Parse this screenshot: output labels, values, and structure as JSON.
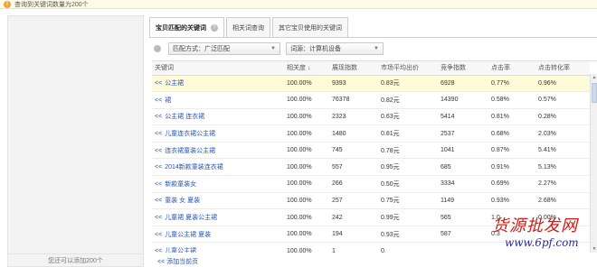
{
  "notice": {
    "text": "查询到关键词数量为200个"
  },
  "left_panel": {
    "footer": "您还可以添加200个"
  },
  "tabs": [
    {
      "label": "宝贝匹配的关键词",
      "active": true
    },
    {
      "label": "相关词查询",
      "active": false
    },
    {
      "label": "其它宝贝使用的关键词",
      "active": false
    }
  ],
  "filters": {
    "match_label": "匹配方式：广泛匹配",
    "source_label": "词源：计算机设备"
  },
  "table": {
    "columns": [
      "关键词",
      "相关度",
      "展现指数",
      "市场平均出价",
      "竞争指数",
      "点击率",
      "点击转化率"
    ],
    "sort_icon": "↓",
    "add_prefix": "<<",
    "rows": [
      {
        "keyword": "公主裙",
        "relevance": "100.00%",
        "impressions": "9393",
        "avg_bid": "0.83元",
        "competition": "6928",
        "ctr": "0.77%",
        "cvr": "0.96%"
      },
      {
        "keyword": "裙",
        "relevance": "100.00%",
        "impressions": "76378",
        "avg_bid": "0.82元",
        "competition": "14390",
        "ctr": "0.58%",
        "cvr": "0.57%"
      },
      {
        "keyword": "公主裙 连衣裙",
        "relevance": "100.00%",
        "impressions": "2323",
        "avg_bid": "0.63元",
        "competition": "5414",
        "ctr": "0.81%",
        "cvr": "0.28%"
      },
      {
        "keyword": "儿童连衣裙公主裙",
        "relevance": "100.00%",
        "impressions": "1480",
        "avg_bid": "0.81元",
        "competition": "2537",
        "ctr": "0.68%",
        "cvr": "2.03%"
      },
      {
        "keyword": "连衣裙童装公主裙",
        "relevance": "100.00%",
        "impressions": "745",
        "avg_bid": "0.78元",
        "competition": "1041",
        "ctr": "0.87%",
        "cvr": "5.41%"
      },
      {
        "keyword": "2014新款童装连衣裙",
        "relevance": "100.00%",
        "impressions": "557",
        "avg_bid": "0.95元",
        "competition": "685",
        "ctr": "0.91%",
        "cvr": "5.13%"
      },
      {
        "keyword": "新款童装女",
        "relevance": "100.00%",
        "impressions": "266",
        "avg_bid": "0.50元",
        "competition": "3334",
        "ctr": "0.69%",
        "cvr": "2.27%"
      },
      {
        "keyword": "童装 女 夏装",
        "relevance": "100.00%",
        "impressions": "257",
        "avg_bid": "0.75元",
        "competition": "1149",
        "ctr": "0.93%",
        "cvr": "2.68%"
      },
      {
        "keyword": "儿童裙 夏装公主裙",
        "relevance": "100.00%",
        "impressions": "242",
        "avg_bid": "0.99元",
        "competition": "565",
        "ctr": "1.0",
        "cvr": "0.00%"
      },
      {
        "keyword": "儿童公主裙 夏装",
        "relevance": "100.00%",
        "impressions": "194",
        "avg_bid": "0.93元",
        "competition": "587",
        "ctr": "0.3",
        "cvr": ""
      },
      {
        "keyword": "儿童公主裙",
        "relevance": "100.00%",
        "impressions": "1",
        "avg_bid": "0.",
        "competition": "",
        "ctr": "",
        "cvr": ""
      }
    ]
  },
  "footer_link": "<<  添加当前页",
  "watermark": {
    "main": "货源批发网",
    "url": "www.6pf.com"
  }
}
